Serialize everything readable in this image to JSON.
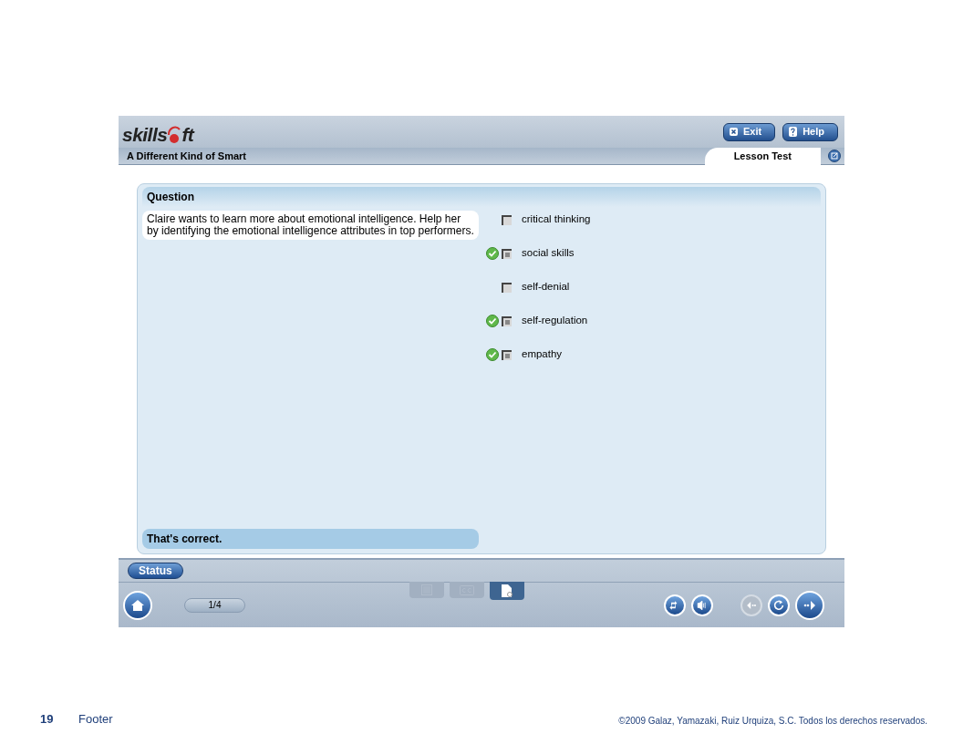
{
  "app": {
    "logo": {
      "before": "skills",
      "after": "ft"
    },
    "course_title": "A Different Kind of Smart",
    "buttons": [
      {
        "kind": "exit",
        "label": "Exit"
      },
      {
        "kind": "help",
        "label": "Help"
      }
    ],
    "section_tab": "Lesson Test"
  },
  "question": {
    "heading": "Question",
    "prompt": "Claire wants to learn more about emotional intelligence. Help her by identifying the emotional intelligence attributes in top performers.",
    "options": [
      {
        "label": "critical thinking",
        "checked": false,
        "correct": false
      },
      {
        "label": "social skills",
        "checked": true,
        "correct": true
      },
      {
        "label": "self-denial",
        "checked": false,
        "correct": false
      },
      {
        "label": "self-regulation",
        "checked": true,
        "correct": true
      },
      {
        "label": "empathy",
        "checked": true,
        "correct": true
      }
    ],
    "feedback": "That's correct."
  },
  "controls": {
    "status_button": "Status",
    "page_counter": "1/4",
    "media_tabs": [
      {
        "kind": "outline",
        "selected": false
      },
      {
        "kind": "captions",
        "selected": false
      },
      {
        "kind": "document",
        "selected": true
      }
    ],
    "right_buttons": [
      {
        "kind": "repeat",
        "disabled": false
      },
      {
        "kind": "audio",
        "disabled": false
      },
      {
        "kind": "back",
        "disabled": true
      },
      {
        "kind": "replay",
        "disabled": false
      },
      {
        "kind": "next",
        "disabled": false
      }
    ]
  },
  "slide_footer": {
    "page_number": "19",
    "label": "Footer",
    "copyright": "©2009 Galaz, Yamazaki, Ruiz Urquiza, S.C. Todos los derechos reservados."
  }
}
